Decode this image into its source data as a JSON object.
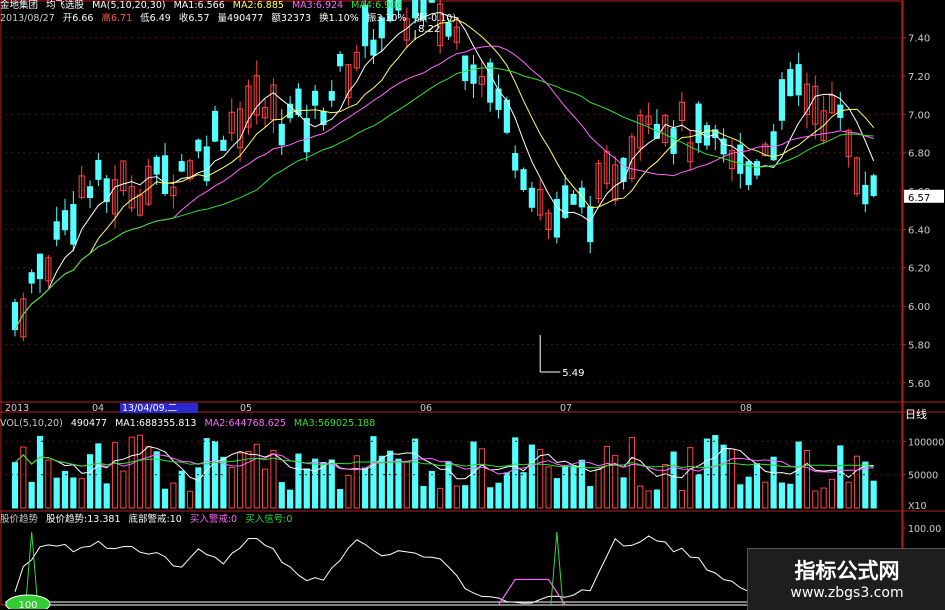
{
  "header": {
    "stock_name": "金地集团",
    "indicator_name": "均飞选股",
    "ma_param": "MA(5,10,20,30)",
    "ma1_label": "MA1:6.566",
    "ma2_label": "MA2:6.885",
    "ma3_label": "MA3:6.924",
    "ma4_label": "MA4:6.906",
    "date": "2013/08/27",
    "open_label": "开6.66",
    "high_label": "高6.71",
    "low_label": "低6.49",
    "close_label": "收6.57",
    "volume_label": "量490477",
    "amount_label": "额32373",
    "turnover_label": "换1.10%",
    "amplitude_label": "振3.30%",
    "change_label": "涨(-0.10)-"
  },
  "vol_header": {
    "param": "VOL(5,10,20)",
    "vol": "490477",
    "ma1": "MA1:688355.813",
    "ma2": "MA2:644768.625",
    "ma3": "MA3:569025.188"
  },
  "ind_header": {
    "name": "股价趋势",
    "value": "股价趋势:13.381",
    "warn": "底部警戒:10",
    "buy_warn": "买入警戒:0",
    "buy_signal": "买入信号:0"
  },
  "period": "日线",
  "watermark": {
    "title": "指标公式网",
    "url": "www.zbgs3.com"
  },
  "colors": {
    "up": "#ff4444",
    "down": "#54ffff",
    "ma1": "#ffffff",
    "ma2": "#ffff66",
    "ma3": "#ff66ff",
    "ma4": "#33dd33",
    "axis": "#b02020",
    "text": "#cccccc"
  },
  "chart_data": {
    "type": "candlestick",
    "price_ticks": [
      "7.40",
      "7.20",
      "7.00",
      "6.80",
      "6.60",
      "6.57",
      "6.40",
      "6.20",
      "6.00",
      "5.80",
      "5.60"
    ],
    "price_range": [
      5.5,
      7.45
    ],
    "high_annotation": "8.22",
    "low_annotation": "5.49",
    "x_labels": [
      "2013",
      "04",
      "13/04/09,二",
      "05",
      "06",
      "07",
      "08"
    ],
    "volume_ticks": [
      "100000",
      "50000",
      "X10"
    ],
    "indicator_ticks": [
      "100.00"
    ],
    "indicator_badge": "100"
  }
}
